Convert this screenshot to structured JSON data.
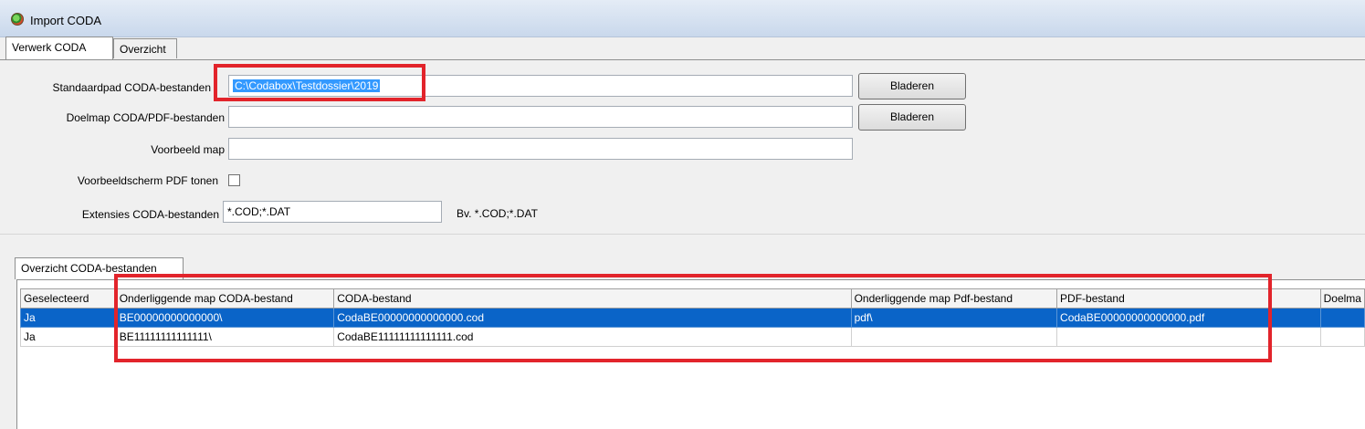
{
  "window": {
    "title": "Import CODA"
  },
  "tabs": [
    {
      "label": "Verwerk CODA"
    },
    {
      "label": "Overzicht"
    }
  ],
  "form": {
    "standaardpad_label": "Standaardpad CODA-bestanden",
    "standaardpad_value": "C:\\Codabox\\Testdossier\\2019",
    "doelmap_label": "Doelmap CODA/PDF-bestanden",
    "doelmap_value": "",
    "voorbeeld_map_label": "Voorbeeld map",
    "voorbeeld_map_value": "",
    "voorbeeldscherm_label": "Voorbeeldscherm PDF tonen",
    "voorbeeldscherm_checked": false,
    "extensies_label": "Extensies CODA-bestanden",
    "extensies_value": "*.COD;*.DAT",
    "extensies_hint": "Bv. *.COD;*.DAT",
    "browse_label": "Bladeren"
  },
  "overview": {
    "tab_label": "Overzicht CODA-bestanden",
    "columns": [
      "Geselecteerd",
      "Onderliggende map CODA-bestand",
      "CODA-bestand",
      "Onderliggende map Pdf-bestand",
      "PDF-bestand",
      "Doelma"
    ],
    "rows": [
      [
        "Ja",
        "BE00000000000000\\",
        "CodaBE00000000000000.cod",
        "pdf\\",
        "CodaBE00000000000000.pdf",
        ""
      ],
      [
        "Ja",
        "BE11111111111111\\",
        "CodaBE11111111111111.cod",
        "",
        "",
        ""
      ]
    ],
    "selected_row": 0
  },
  "colors": {
    "selection": "#0a64c8",
    "highlight_box": "#e2242b",
    "text_selection": "#3399ff"
  }
}
